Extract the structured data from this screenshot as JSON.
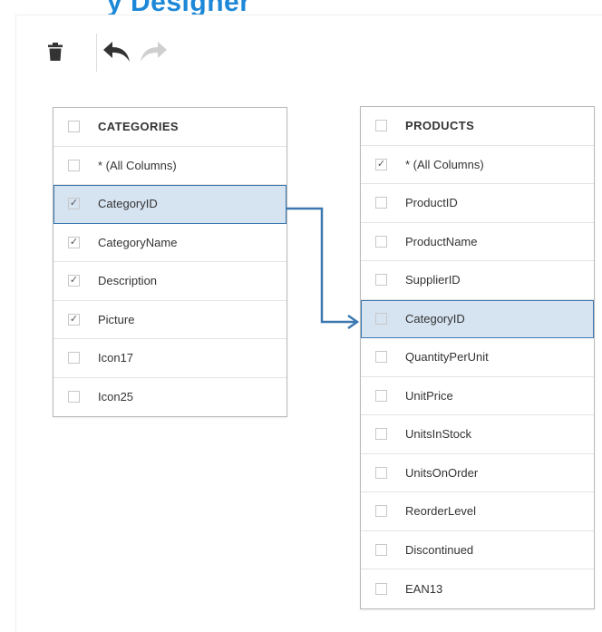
{
  "page": {
    "title_fragment": "y Designer"
  },
  "toolbar": {
    "delete_icon": "trash-icon",
    "undo_icon": "undo-icon",
    "redo_icon": "redo-icon"
  },
  "colors": {
    "accent": "#1e88d8",
    "selection_bg": "#d6e3f1",
    "selection_border": "#3b78b0",
    "connector": "#3b78b0"
  },
  "categories_table": {
    "title": "CATEGORIES",
    "header_checked": false,
    "fields": [
      {
        "label": "* (All Columns)",
        "checked": false,
        "selected": false,
        "check": ""
      },
      {
        "label": "CategoryID",
        "checked": true,
        "selected": true,
        "check": "✓"
      },
      {
        "label": "CategoryName",
        "checked": true,
        "selected": false,
        "check": "✓"
      },
      {
        "label": "Description",
        "checked": true,
        "selected": false,
        "check": "✓"
      },
      {
        "label": "Picture",
        "checked": true,
        "selected": false,
        "check": "✓"
      },
      {
        "label": "Icon17",
        "checked": false,
        "selected": false,
        "check": ""
      },
      {
        "label": "Icon25",
        "checked": false,
        "selected": false,
        "check": ""
      }
    ]
  },
  "products_table": {
    "title": "PRODUCTS",
    "header_checked": false,
    "fields": [
      {
        "label": "* (All Columns)",
        "checked": true,
        "selected": false,
        "check": "✓"
      },
      {
        "label": "ProductID",
        "checked": false,
        "selected": false,
        "check": ""
      },
      {
        "label": "ProductName",
        "checked": false,
        "selected": false,
        "check": ""
      },
      {
        "label": "SupplierID",
        "checked": false,
        "selected": false,
        "check": ""
      },
      {
        "label": "CategoryID",
        "checked": false,
        "selected": true,
        "check": ""
      },
      {
        "label": "QuantityPerUnit",
        "checked": false,
        "selected": false,
        "check": ""
      },
      {
        "label": "UnitPrice",
        "checked": false,
        "selected": false,
        "check": ""
      },
      {
        "label": "UnitsInStock",
        "checked": false,
        "selected": false,
        "check": ""
      },
      {
        "label": "UnitsOnOrder",
        "checked": false,
        "selected": false,
        "check": ""
      },
      {
        "label": "ReorderLevel",
        "checked": false,
        "selected": false,
        "check": ""
      },
      {
        "label": "Discontinued",
        "checked": false,
        "selected": false,
        "check": ""
      },
      {
        "label": "EAN13",
        "checked": false,
        "selected": false,
        "check": ""
      }
    ]
  },
  "relation": {
    "from": "CATEGORIES.CategoryID",
    "to": "PRODUCTS.CategoryID"
  }
}
